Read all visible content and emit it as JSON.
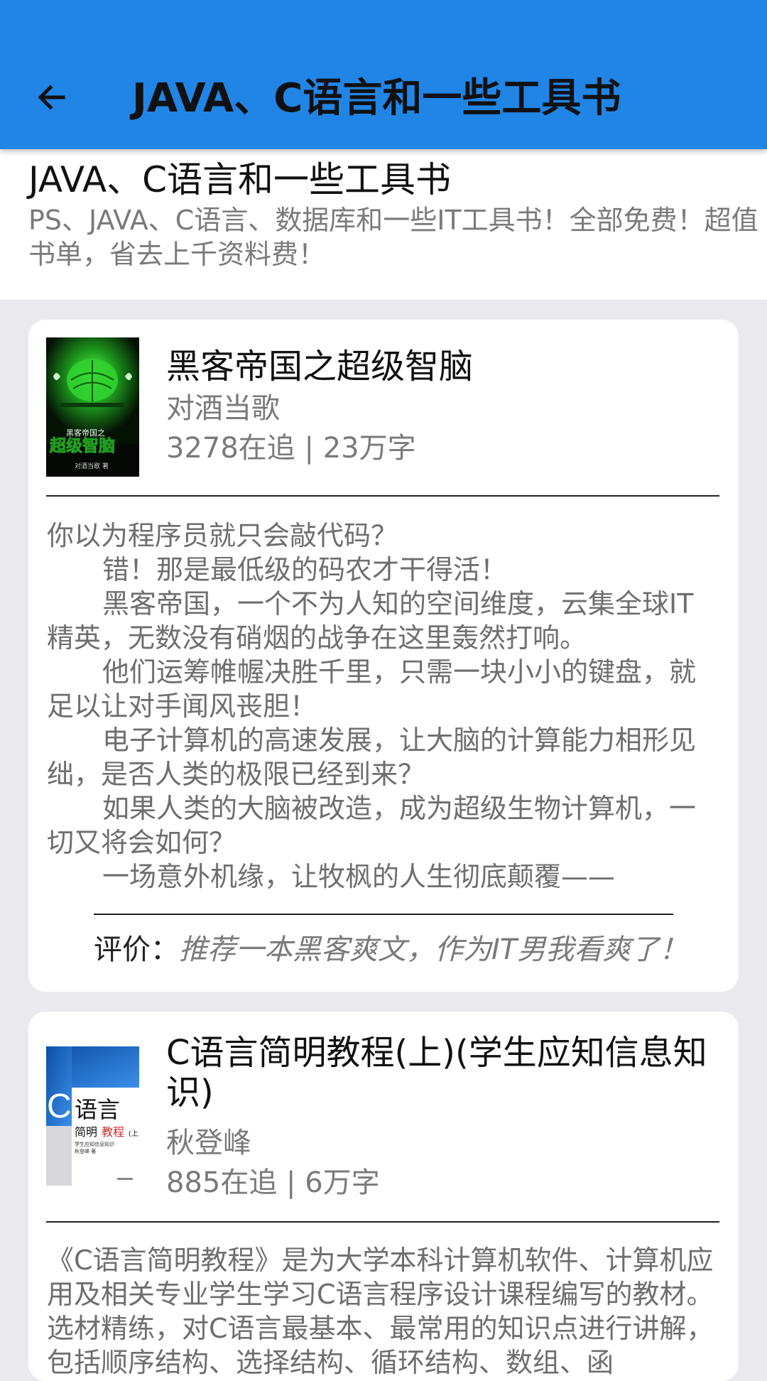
{
  "app_bar": {
    "title": "JAVA、C语言和一些工具书",
    "background_color": "#2185e6",
    "back_icon": "arrow-left-icon"
  },
  "list_header": {
    "title": "JAVA、C语言和一些工具书",
    "description": "PS、JAVA、C语言、数据库和一些IT工具书！全部免费！超值书单，省去上千资料费！"
  },
  "books": [
    {
      "title": "黑客帝国之超级智脑",
      "author": "对酒当歌",
      "stats": "3278在追 | 23万字",
      "cover_text": {
        "series": "黑客帝国之",
        "title": "超级智脑",
        "author": "对酒当歌 著"
      },
      "description": [
        "你以为程序员就只会敲代码？",
        "错！那是最低级的码农才干得活！",
        "黑客帝国，一个不为人知的空间维度，云集全球IT精英，无数没有硝烟的战争在这里轰然打响。",
        "他们运筹帷幄决胜千里，只需一块小小的键盘，就足以让对手闻风丧胆！",
        "电子计算机的高速发展，让大脑的计算能力相形见绌，是否人类的极限已经到来？",
        "如果人类的大脑被改造，成为超级生物计算机，一切又将会如何？",
        "一场意外机缘，让牧枫的人生彻底颠覆——"
      ],
      "review_label": "评价：",
      "review_text": "推荐一本黑客爽文，作为IT男我看爽了！"
    },
    {
      "title": "C语言简明教程(上)(学生应知信息知识)",
      "author": "秋登峰",
      "stats": "885在追 | 6万字",
      "cover_text": {
        "c": "C",
        "lang": "语言",
        "simple": "简明",
        "course": "教程",
        "part": "(上",
        "sub": "学生应知信息知识",
        "author": "秋登峰 著"
      },
      "description": [
        "《C语言简明教程》是为大学本科计算机软件、计算机应用及相关专业学生学习C语言程序设计课程编写的教材。选材精练，对C语言最基本、最常用的知识点进行讲解，包括顺序结构、选择结构、循环结构、数组、函"
      ]
    }
  ]
}
